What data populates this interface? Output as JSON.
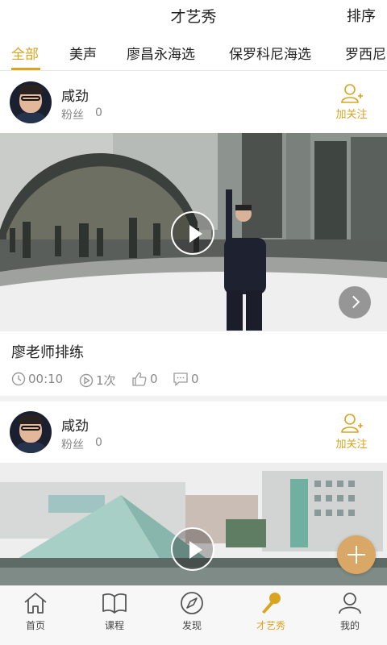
{
  "header": {
    "title": "才艺秀",
    "sort_label": "排序"
  },
  "tabs": [
    {
      "label": "全部",
      "active": true
    },
    {
      "label": "美声",
      "active": false
    },
    {
      "label": "廖昌永海选",
      "active": false
    },
    {
      "label": "保罗科尼海选",
      "active": false
    },
    {
      "label": "罗西尼",
      "active": false
    }
  ],
  "posts": [
    {
      "username": "咸劲",
      "fans_label": "粉丝",
      "fans_count": "0",
      "follow_label": "加关注",
      "title": "廖老师排练",
      "duration": "00:10",
      "plays": "1次",
      "likes": "0",
      "comments": "0"
    },
    {
      "username": "咸劲",
      "fans_label": "粉丝",
      "fans_count": "0",
      "follow_label": "加关注"
    }
  ],
  "bottom_nav": [
    {
      "label": "首页",
      "icon": "home-icon",
      "active": false
    },
    {
      "label": "课程",
      "icon": "book-icon",
      "active": false
    },
    {
      "label": "发现",
      "icon": "compass-icon",
      "active": false
    },
    {
      "label": "才艺秀",
      "icon": "microphone-icon",
      "active": true
    },
    {
      "label": "我的",
      "icon": "user-icon",
      "active": false
    }
  ],
  "colors": {
    "accent": "#d9a520",
    "fab": "#d9a866",
    "text_muted": "#888888"
  }
}
